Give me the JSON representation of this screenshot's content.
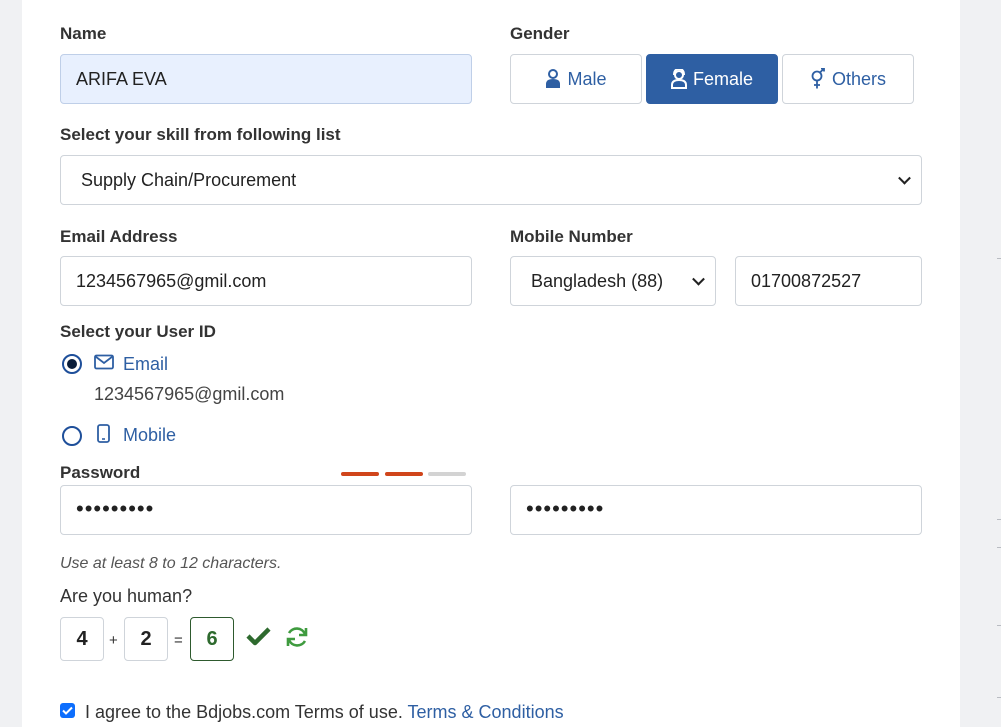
{
  "form": {
    "name": {
      "label": "Name",
      "value": "ARIFA EVA"
    },
    "gender": {
      "label": "Gender",
      "options": [
        {
          "label": "Male",
          "icon": "male-user-icon",
          "selected": false
        },
        {
          "label": "Female",
          "icon": "female-user-icon",
          "selected": true
        },
        {
          "label": "Others",
          "icon": "gender-symbol-icon",
          "selected": false
        }
      ]
    },
    "skill": {
      "label": "Select your skill from following list",
      "value": "Supply Chain/Procurement"
    },
    "email": {
      "label": "Email Address",
      "value": "1234567965@gmil.com"
    },
    "mobile": {
      "label": "Mobile Number",
      "country": "Bangladesh (88)",
      "value": "01700872527"
    },
    "user_id": {
      "label": "Select your User ID",
      "options": [
        {
          "label": "Email",
          "icon": "envelope-icon",
          "detail": "1234567965@gmil.com",
          "selected": true
        },
        {
          "label": "Mobile",
          "icon": "mobile-phone-icon",
          "selected": false
        }
      ]
    },
    "password": {
      "label": "Password",
      "value_masked": "•••••••••",
      "confirm_masked": "•••••••••",
      "strength_colors": [
        "#d0451b",
        "#d0451b",
        "#d3d3d3"
      ],
      "hint": "Use at least 8 to 12 characters."
    },
    "captcha": {
      "label": "Are you human?",
      "a": "4",
      "plus": "+",
      "b": "2",
      "equals": "=",
      "answer": "6",
      "icons": [
        "checkmark-icon",
        "refresh-icon"
      ],
      "accent": "#2e6a2e"
    },
    "terms": {
      "checked": true,
      "text": "I agree to the Bdjobs.com Terms of use.",
      "link": "Terms & Conditions"
    }
  },
  "colors": {
    "primary": "#2e5fa3",
    "name_bg": "#e8f0fe",
    "strength": "#d0451b"
  }
}
